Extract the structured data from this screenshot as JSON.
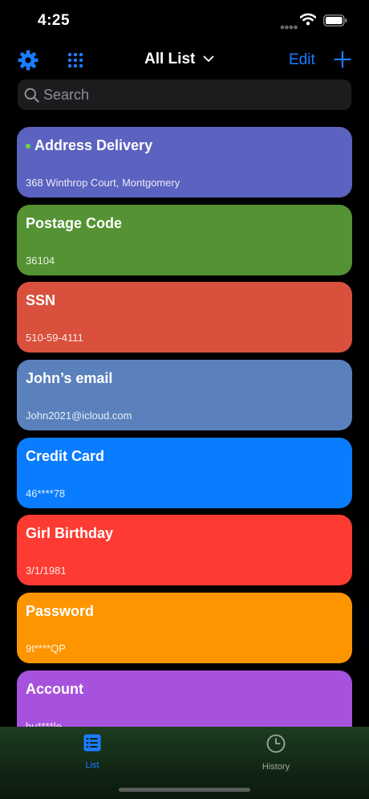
{
  "status_bar": {
    "time": "4:25"
  },
  "nav": {
    "title": "All List",
    "edit_label": "Edit"
  },
  "search": {
    "placeholder": "Search",
    "value": ""
  },
  "cards": [
    {
      "title": "Address Delivery",
      "value": "368 Winthrop Court, Montgomery",
      "color": "#5b62bf",
      "active": true
    },
    {
      "title": "Postage Code",
      "value": "36104",
      "color": "#549233"
    },
    {
      "title": "SSN",
      "value": "510-59-4111",
      "color": "#d9503d"
    },
    {
      "title": "John’s email",
      "value": "John2021@icloud.com",
      "color": "#5a81bc"
    },
    {
      "title": "Credit Card",
      "value": "46****78",
      "color": "#0a7cff"
    },
    {
      "title": "Girl Birthday",
      "value": "3/1/1981",
      "color": "#fd3b32"
    },
    {
      "title": "Password",
      "value": "9t****QP",
      "color": "#fd9500"
    },
    {
      "title": "Account",
      "value": "hu****le",
      "color": "#a752dd"
    }
  ],
  "tabs": [
    {
      "label": "List",
      "active": true
    },
    {
      "label": "History",
      "active": false
    }
  ],
  "colors": {
    "accent": "#1a7cff",
    "active_dot": "#66dd44",
    "tab_active": "#1a7cff",
    "tab_inactive": "#a0a8a0"
  }
}
